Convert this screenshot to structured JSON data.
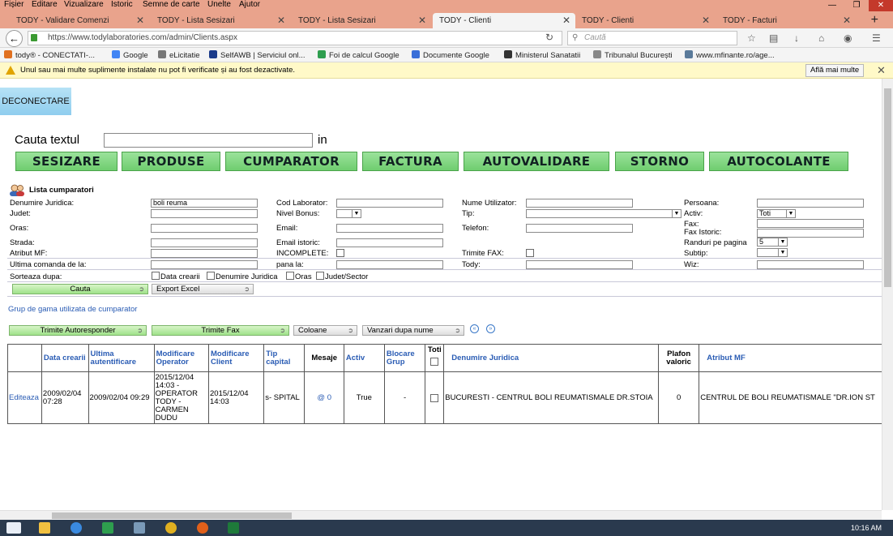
{
  "menu": [
    "Fișier",
    "Editare",
    "Vizualizare",
    "Istoric",
    "Semne de carte",
    "Unelte",
    "Ajutor"
  ],
  "tabs": [
    {
      "label": "TODY - Validare Comenzi"
    },
    {
      "label": "TODY - Lista Sesizari"
    },
    {
      "label": "TODY - Lista Sesizari"
    },
    {
      "label": "TODY - Clienti"
    },
    {
      "label": "TODY - Clienti"
    },
    {
      "label": "TODY - Facturi"
    }
  ],
  "new_tab_glyph": "+",
  "address": {
    "url": "https://www.todylaboratories.com/admin/Clients.aspx",
    "search_placeholder": "Caută"
  },
  "bookmarks": [
    {
      "label": "tody® - CONECTATI-...",
      "color": "#e07020"
    },
    {
      "label": "Google",
      "color": "#4285f4"
    },
    {
      "label": "eLicitatie",
      "color": "#777777"
    },
    {
      "label": "SelfAWB | Serviciul onl...",
      "color": "#1a3a8a"
    },
    {
      "label": "Foi de calcul Google",
      "color": "#2e9e4e"
    },
    {
      "label": "Documente Google",
      "color": "#3b6fd8"
    },
    {
      "label": "Ministerul Sanatatii",
      "color": "#333333"
    },
    {
      "label": "Tribunalul București",
      "color": "#888888"
    },
    {
      "label": "www.mfinante.ro/age...",
      "color": "#5a7a9a"
    }
  ],
  "notification": {
    "text": "Unul sau mai multe suplimente instalate nu pot fi verificate și au fost dezactivate.",
    "button": "Află mai multe"
  },
  "page": {
    "logout": "DECONECTARE",
    "search_label": "Cauta textul",
    "search_value": "",
    "in_label": "in",
    "big_buttons": [
      "SESIZARE",
      "PRODUSE",
      "CUMPARATOR",
      "FACTURA",
      "AUTOVALIDARE",
      "STORNO",
      "AUTOCOLANTE"
    ],
    "list_title": "Lista cumparatori",
    "filters": {
      "denumire_juridica": {
        "label": "Denumire Juridica:",
        "value": "boli reuma"
      },
      "cod_laborator": {
        "label": "Cod Laborator:",
        "value": ""
      },
      "nume_utilizator": {
        "label": "Nume Utilizator:",
        "value": ""
      },
      "persoana": {
        "label": "Persoana:",
        "value": ""
      },
      "judet": {
        "label": "Judet:",
        "value": ""
      },
      "nivel_bonus": {
        "label": "Nivel Bonus:",
        "value": ""
      },
      "tip": {
        "label": "Tip:",
        "value": ""
      },
      "activ": {
        "label": "Activ:",
        "value": "Toti"
      },
      "oras": {
        "label": "Oras:",
        "value": ""
      },
      "email": {
        "label": "Email:",
        "value": ""
      },
      "telefon": {
        "label": "Telefon:",
        "value": ""
      },
      "fax": {
        "label": "Fax:",
        "value": ""
      },
      "fax_istoric": {
        "label": "Fax Istoric:",
        "value": ""
      },
      "strada": {
        "label": "Strada:",
        "value": ""
      },
      "email_istoric": {
        "label": "Email istoric:",
        "value": ""
      },
      "randuri": {
        "label": "Randuri pe pagina",
        "value": "5"
      },
      "atribut_mf": {
        "label": "Atribut MF:",
        "value": ""
      },
      "incomplete": {
        "label": "INCOMPLETE:",
        "checked": false
      },
      "trimite_fax": {
        "label": "Trimite FAX:",
        "checked": false
      },
      "subtip": {
        "label": "Subtip:",
        "value": ""
      },
      "ultima_comanda": {
        "label": "Ultima comanda de la:",
        "value": ""
      },
      "pana_la": {
        "label": "pana la:",
        "value": ""
      },
      "tody": {
        "label": "Tody:",
        "value": ""
      },
      "wiz": {
        "label": "Wiz:",
        "value": ""
      }
    },
    "sort": {
      "label": "Sorteaza dupa:",
      "options": [
        "Data crearii",
        "Denumire Juridica",
        "Oras",
        "Judet/Sector"
      ]
    },
    "btn_cauta": "Cauta",
    "btn_export": "Export Excel",
    "grup_link": "Grup de gama utilizata de cumparator",
    "btn_autoresponder": "Trimite Autoresponder",
    "btn_fax": "Trimite Fax",
    "btn_coloane": "Coloane",
    "btn_vanzari": "Vanzari dupa nume",
    "pager_prev": "«",
    "pager_next": "»"
  },
  "grid": {
    "headers": [
      "",
      "Data crearii",
      "Ultima autentificare",
      "Modificare Operator",
      "Modificare Client",
      "Tip capital",
      "Mesaje",
      "Activ",
      "Blocare Grup",
      "Toti",
      "Denumire Juridica",
      "Plafon valoric",
      "Atribut MF"
    ],
    "rows": [
      {
        "action": "Editeaza",
        "data_crearii": "2009/02/04 07:28",
        "ultima_autentificare": "2009/02/04 09:29",
        "modificare_operator": "2015/12/04 14:03 - OPERATOR TODY - CARMEN DUDU",
        "modificare_client": "2015/12/04 14:03",
        "tip_capital": "s- SPITAL",
        "mesaje": "@ 0",
        "activ": "True",
        "blocare_grup": "-",
        "denumire_juridica": "BUCURESTI - CENTRUL BOLI REUMATISMALE DR.STOIA",
        "plafon_valoric": "0",
        "atribut_mf": "CENTRUL DE BOLI REUMATISMALE \"DR.ION ST"
      }
    ]
  },
  "taskbar": {
    "clock": "10:16 AM"
  }
}
